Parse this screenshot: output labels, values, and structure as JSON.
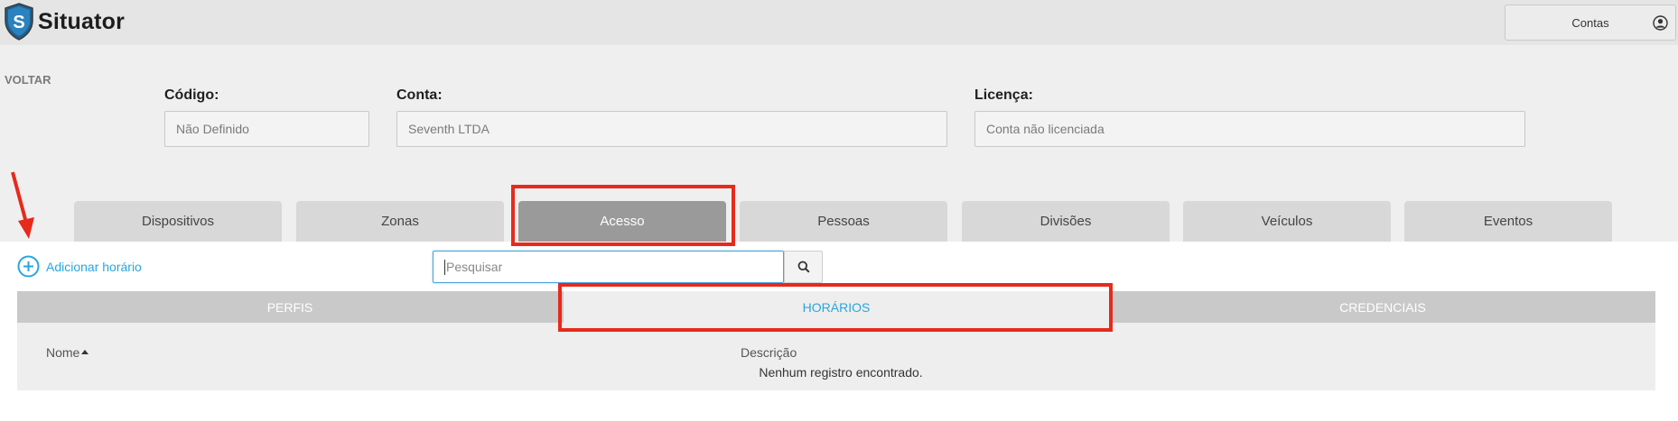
{
  "header": {
    "app_name": "Situator",
    "logo_letter": "S",
    "account_label": "Contas",
    "account_icon": "user-circle-icon"
  },
  "form": {
    "back_label": "VOLTAR",
    "codigo_label": "Código:",
    "codigo_value": "Não Definido",
    "conta_label": "Conta:",
    "conta_value": "Seventh LTDA",
    "licenca_label": "Licença:",
    "licenca_value": "Conta não licenciada"
  },
  "tabs": [
    {
      "label": "Dispositivos",
      "active": false
    },
    {
      "label": "Zonas",
      "active": false
    },
    {
      "label": "Acesso",
      "active": true
    },
    {
      "label": "Pessoas",
      "active": false
    },
    {
      "label": "Divisões",
      "active": false
    },
    {
      "label": "Veículos",
      "active": false
    },
    {
      "label": "Eventos",
      "active": false
    }
  ],
  "content": {
    "add_label": "Adicionar horário",
    "add_icon": "plus-circle-icon",
    "search_placeholder": "Pesquisar",
    "search_icon": "search-icon",
    "subtabs": [
      {
        "label": "PERFIS",
        "active": false
      },
      {
        "label": "HORÁRIOS",
        "active": true
      },
      {
        "label": "CREDENCIAIS",
        "active": false
      }
    ],
    "columns": [
      "Nome",
      "Descrição"
    ],
    "empty_message": "Nenhum registro encontrado."
  },
  "colors": {
    "accent": "#29a6dd",
    "annotation": "#e62a1c",
    "active_tab": "#9a9a9a",
    "tab": "#d8d8d8"
  }
}
